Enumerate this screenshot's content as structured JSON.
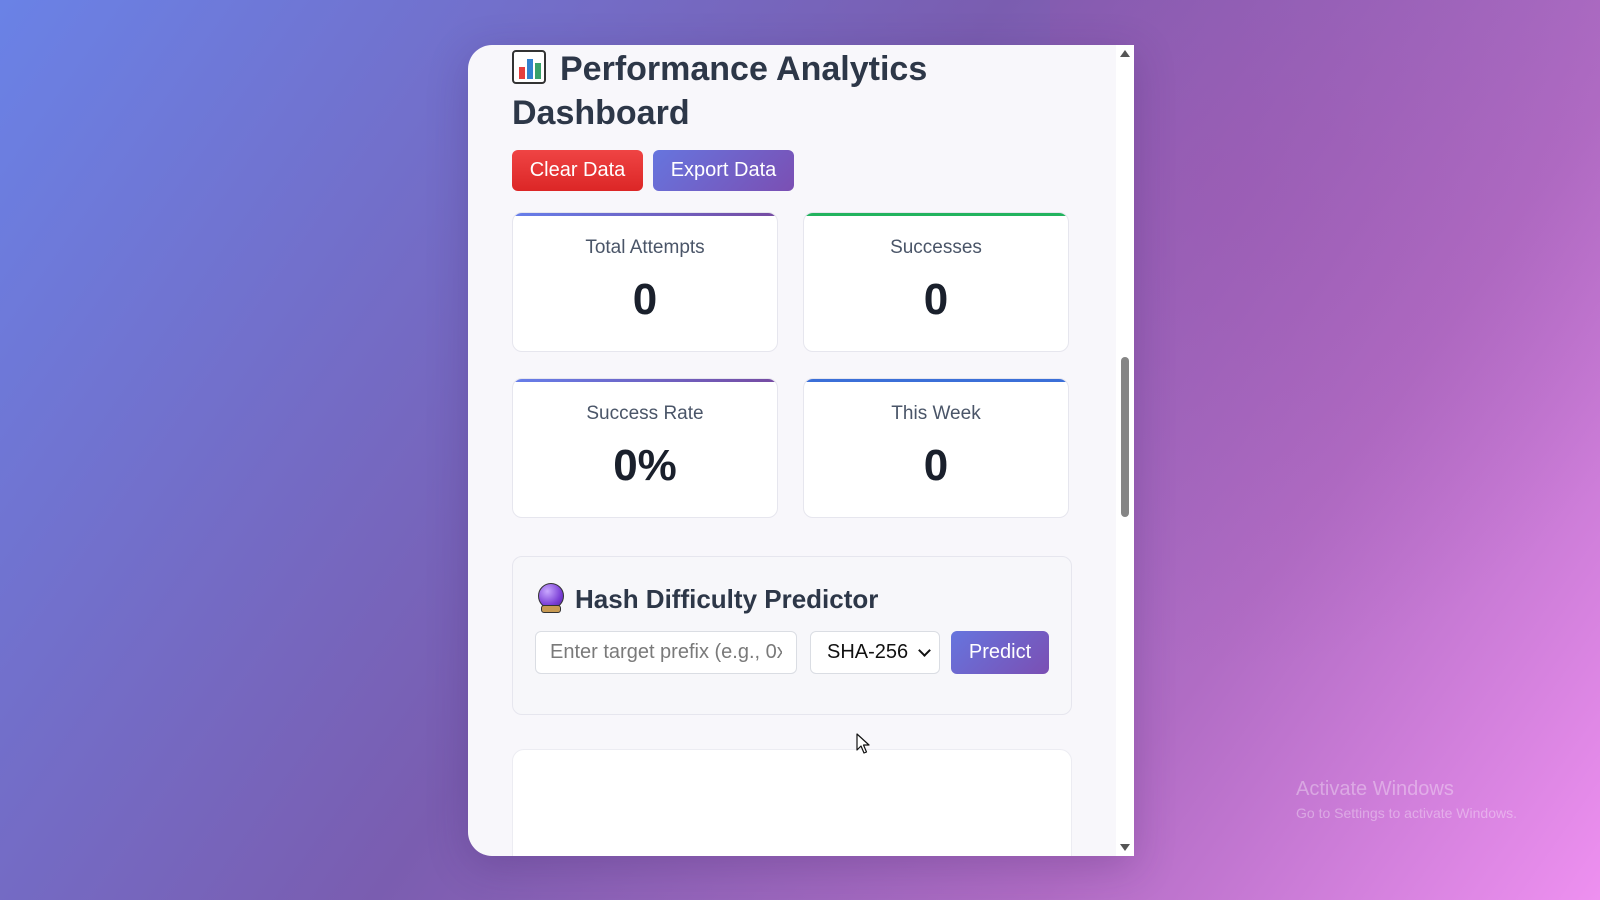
{
  "dashboard": {
    "title": "Performance Analytics Dashboard",
    "title_icon": "bar-chart-icon",
    "buttons": {
      "clear": "Clear Data",
      "export": "Export Data"
    },
    "stats": [
      {
        "label": "Total Attempts",
        "value": "0",
        "accent": "#764ba2"
      },
      {
        "label": "Successes",
        "value": "0",
        "accent": "#22b35e"
      },
      {
        "label": "Success Rate",
        "value": "0%",
        "accent": "#764ba2"
      },
      {
        "label": "This Week",
        "value": "0",
        "accent": "#3b6fd8"
      }
    ]
  },
  "predictor": {
    "title": "Hash Difficulty Predictor",
    "icon": "crystal-ball-icon",
    "input_placeholder": "Enter target prefix (e.g., 0x",
    "algorithm_selected": "SHA-256",
    "predict_label": "Predict"
  },
  "watermark": {
    "line1": "Activate Windows",
    "line2": "Go to Settings to activate Windows."
  },
  "colors": {
    "clear_button": "#e53e3e",
    "primary_gradient_start": "#667eea",
    "primary_gradient_end": "#764ba2"
  }
}
